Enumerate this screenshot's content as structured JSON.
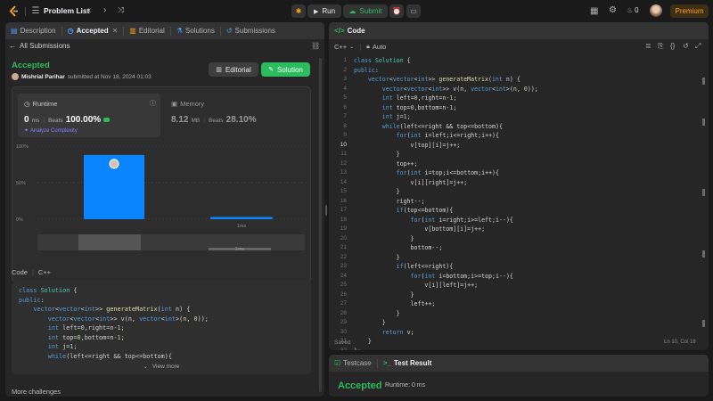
{
  "topbar": {
    "problem_list": "Problem List",
    "run": "Run",
    "submit": "Submit",
    "coins": "0",
    "premium": "Premium"
  },
  "left_tabs": [
    {
      "label": "Description"
    },
    {
      "label": "Accepted"
    },
    {
      "label": "Editorial"
    },
    {
      "label": "Solutions"
    },
    {
      "label": "Submissions"
    }
  ],
  "submission": {
    "back_label": "All Submissions",
    "status": "Accepted",
    "user": "Mishrial Parihar",
    "submitted_text": "submitted at Nov 18, 2024 01:03",
    "editorial_btn": "Editorial",
    "solution_btn": "Solution"
  },
  "runtime": {
    "label": "Runtime",
    "value": "0",
    "unit": "ms",
    "beats_label": "Beats",
    "beats": "100.00%",
    "analyze": "Analyze Complexity"
  },
  "memory": {
    "label": "Memory",
    "value": "8.12",
    "unit": "MB",
    "beats_label": "Beats",
    "beats": "28.10%"
  },
  "chart_data": {
    "type": "bar",
    "y_ticks": [
      "100%",
      "50%",
      "0%"
    ],
    "ylim": [
      0,
      100
    ],
    "bars": [
      {
        "value": 88,
        "color": "#0a84ff",
        "highlight": true
      },
      {
        "value": 3,
        "color": "#0a84ff",
        "label": "1ms"
      }
    ],
    "scrubber_label": "1ms"
  },
  "code_section": {
    "label": "Code",
    "lang": "C++",
    "view_more": "View more",
    "more_challenges": "More challenges"
  },
  "preview_lines": [
    "class Solution {",
    "public:",
    "    vector<vector<int>> generateMatrix(int n) {",
    "        vector<vector<int>> v(n, vector<int>(n, 0));",
    "        int left=0,right=n-1;",
    "        int top=0,bottom=n-1;",
    "        int j=1;",
    "        while(left<=right && top<=bottom){"
  ],
  "editor": {
    "title": "Code",
    "lang": "C++",
    "auto": "Auto",
    "saved": "Saved",
    "position": "Ln 10, Col 18"
  },
  "code_lines": [
    "class Solution {",
    "public:",
    "    vector<vector<int>> generateMatrix(int n) {",
    "        vector<vector<int>> v(n, vector<int>(n, 0));",
    "        int left=0,right=n-1;",
    "        int top=0,bottom=n-1;",
    "        int j=1;",
    "        while(left<=right && top<=bottom){",
    "            for(int i=left;i<=right;i++){",
    "                v[top][i]=j++;",
    "            }",
    "            top++;",
    "            for(int i=top;i<=bottom;i++){",
    "                v[i][right]=j++;",
    "            }",
    "            right--;",
    "            if(top<=bottom){",
    "                for(int i=right;i>=left;i--){",
    "                    v[bottom][i]=j++;",
    "                }",
    "                bottom--;",
    "            }",
    "            if(left<=right){",
    "                for(int i=bottom;i>=top;i--){",
    "                    v[i][left]=j++;",
    "                }",
    "                left++;",
    "            }",
    "        }",
    "        return v;",
    "    }",
    "};",
    ""
  ],
  "result": {
    "testcase_tab": "Testcase",
    "result_tab": "Test Result",
    "status": "Accepted",
    "runtime": "Runtime: 0 ms"
  },
  "colors": {
    "accent_green": "#2cbb5d",
    "premium": "#ffa116",
    "bar_blue": "#0a84ff"
  }
}
